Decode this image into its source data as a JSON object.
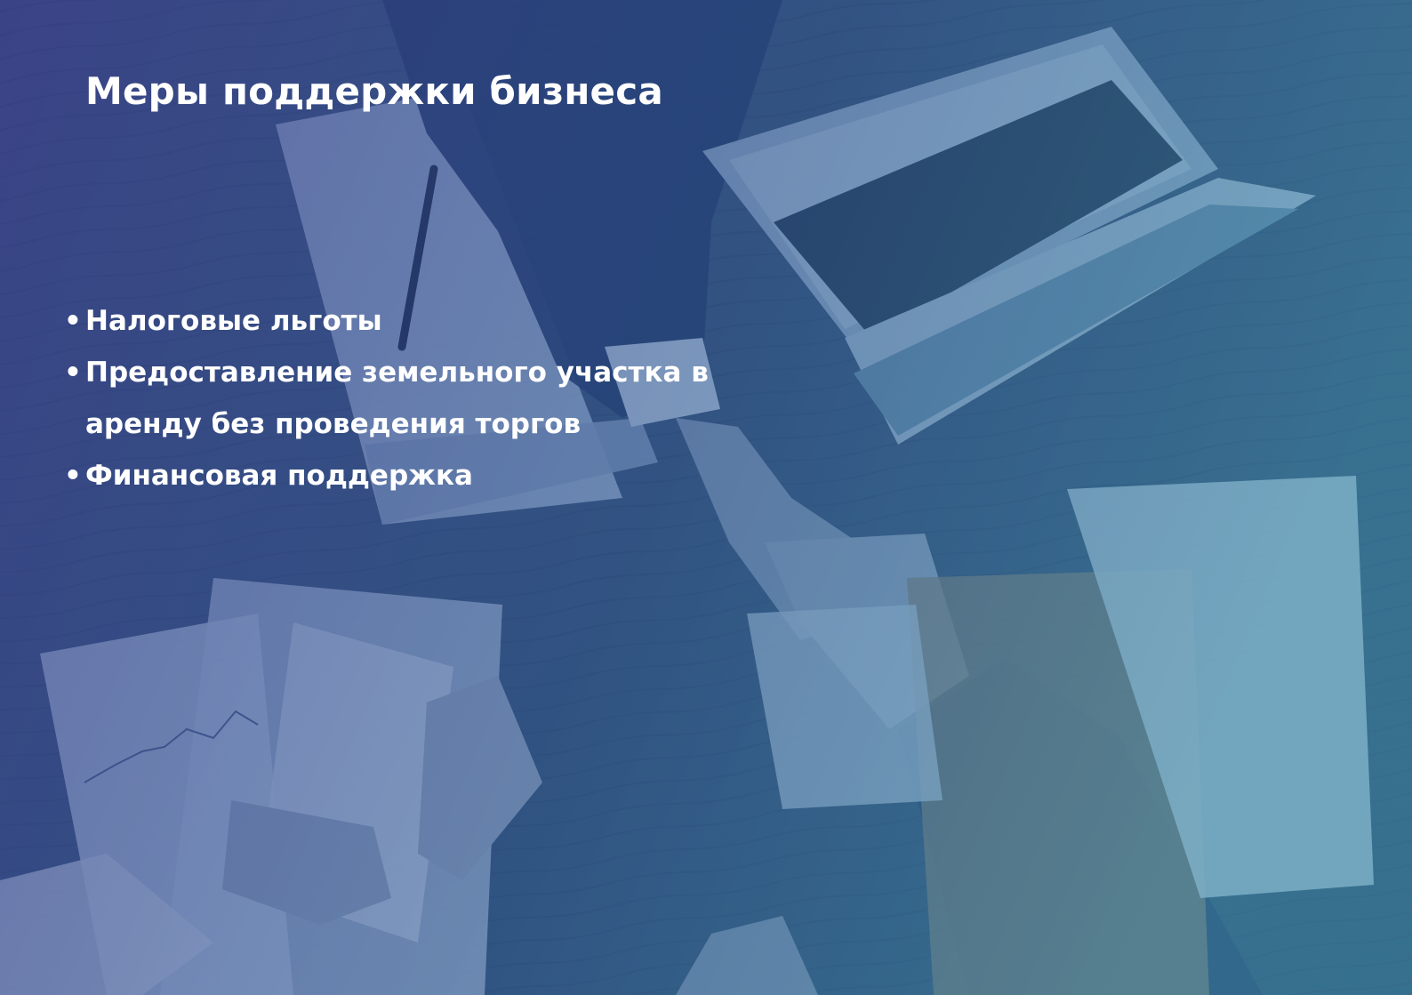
{
  "slide": {
    "title": "Меры поддержки бизнеса",
    "bullets": [
      {
        "marker": "•",
        "text": "Налоговые льготы"
      },
      {
        "marker": "•",
        "text": "Предоставление земельного участка в аренду без проведения торгов"
      },
      {
        "marker": "•",
        "text": "Финансовая поддержка"
      }
    ]
  },
  "colors": {
    "overlay_left": "#3a3f8f",
    "overlay_right": "#3f8fb0",
    "text": "#ffffff"
  }
}
